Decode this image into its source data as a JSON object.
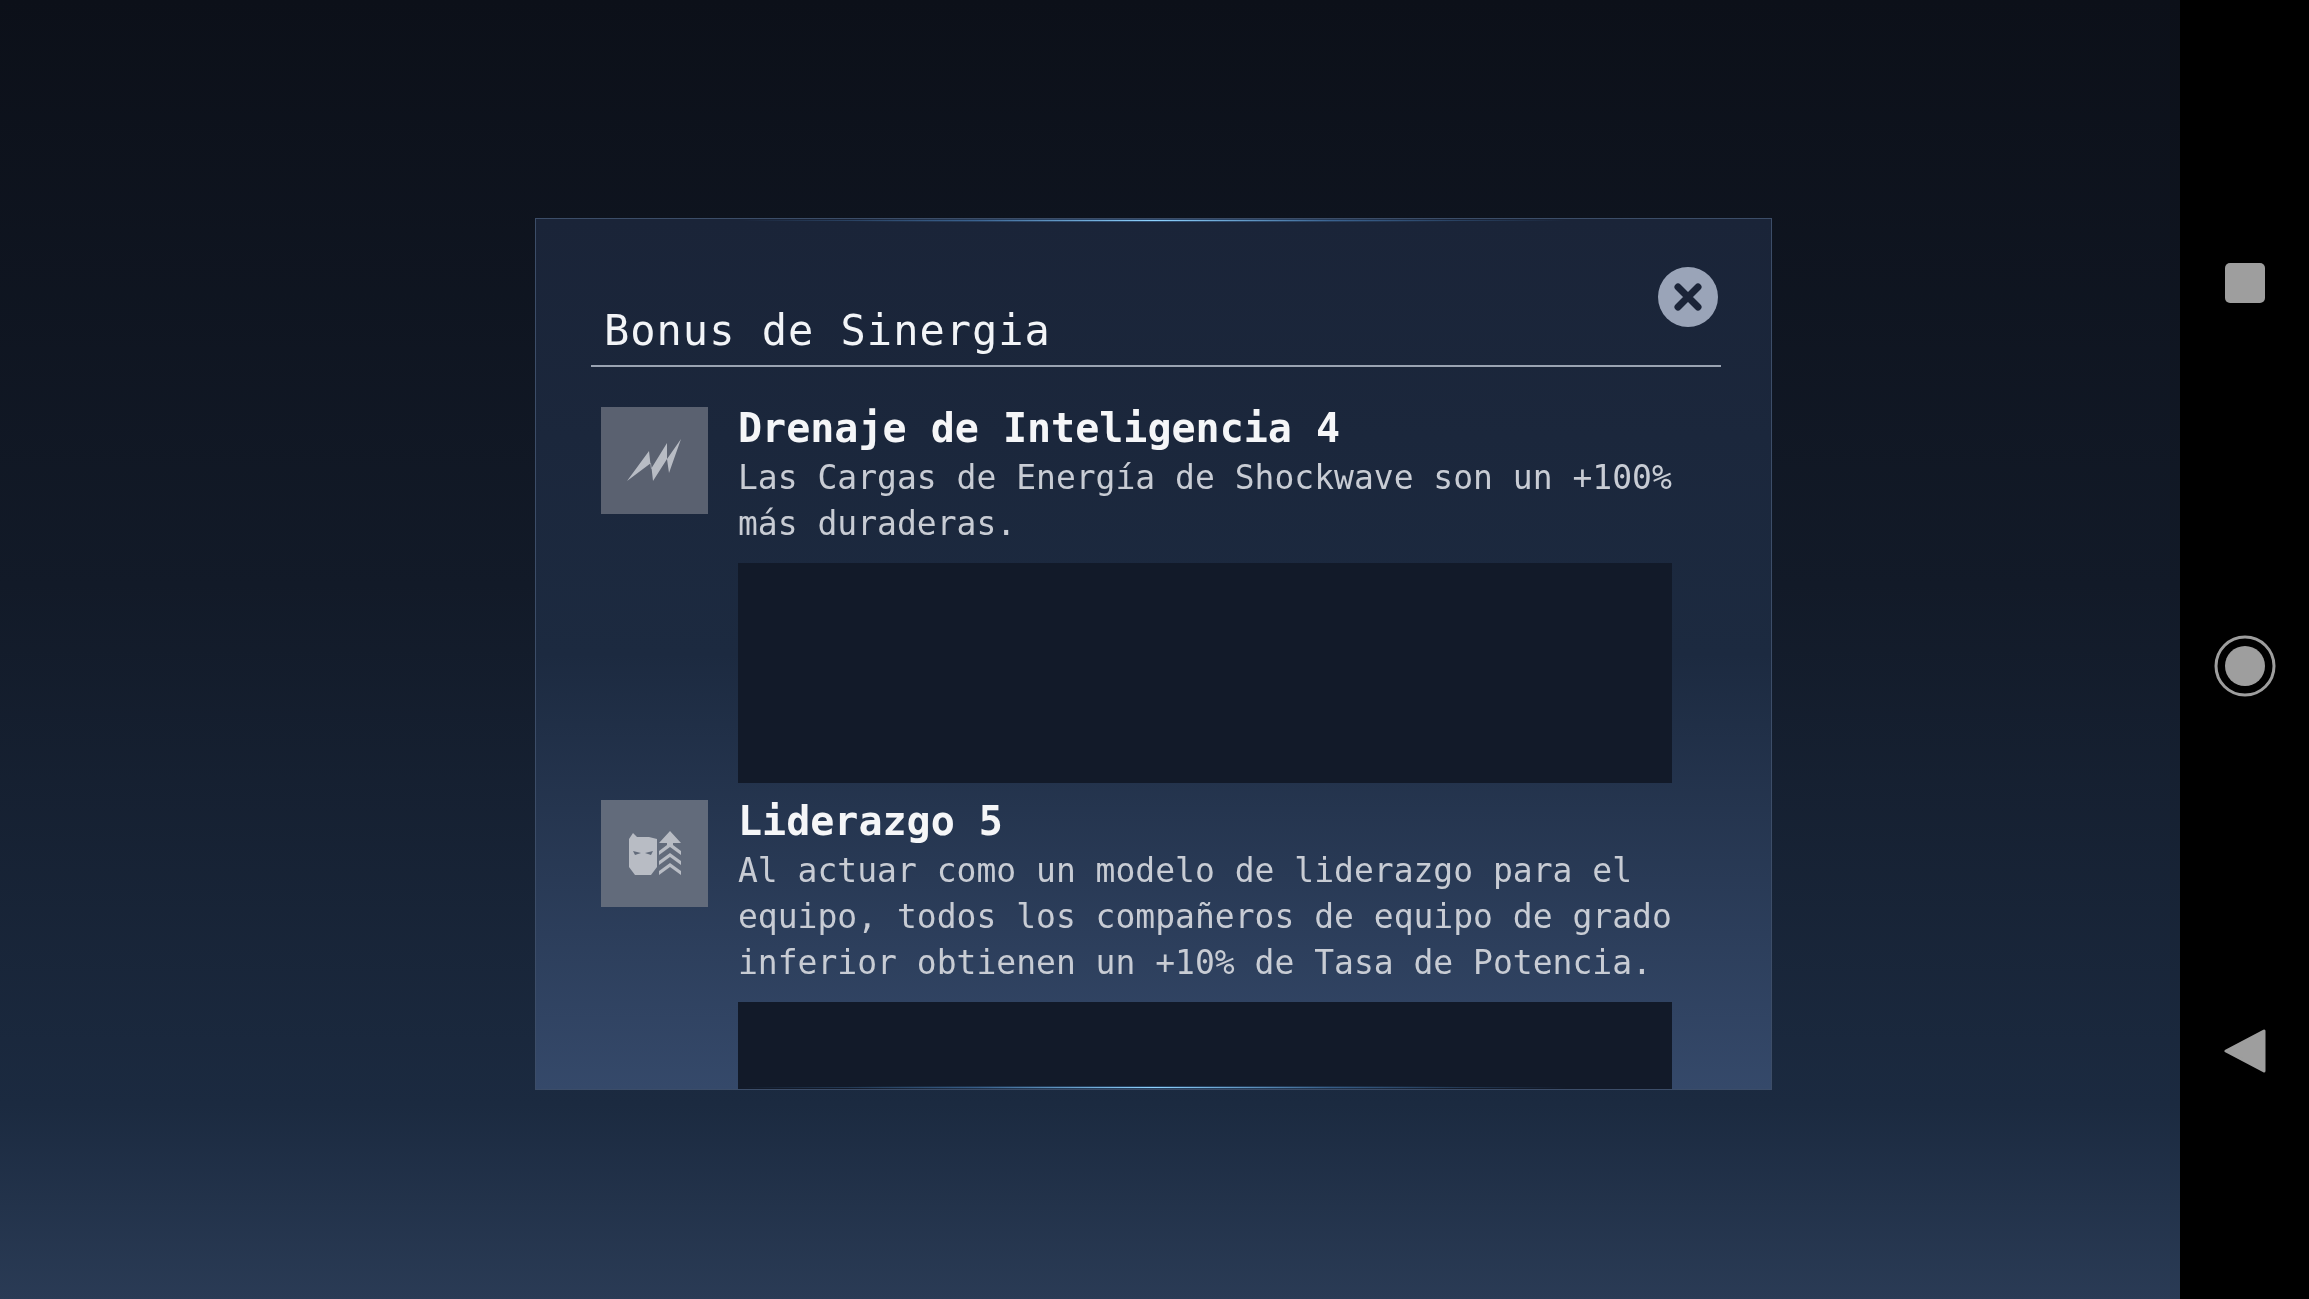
{
  "dialog": {
    "title": "Bonus de Sinergia",
    "bonuses": [
      {
        "kind": "energy",
        "name": "Drenaje de Inteligencia 4",
        "description": "Las Cargas de Energía de Shockwave son un +100% más duraderas."
      },
      {
        "kind": "leader",
        "name": "Liderazgo 5",
        "description": "Al actuar como un modelo de liderazgo para el equipo, todos los compañeros de equipo de grado inferior obtienen un +10% de Tasa de Potencia."
      }
    ]
  }
}
